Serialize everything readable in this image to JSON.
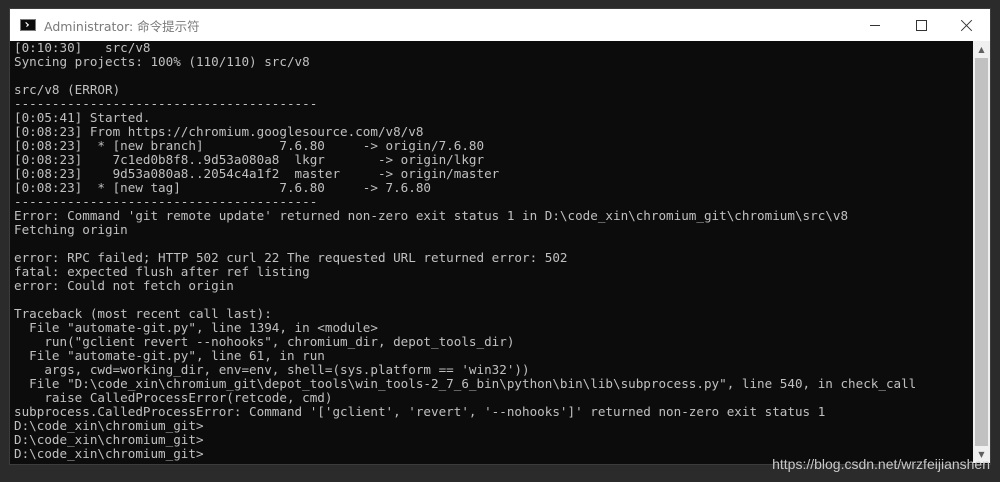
{
  "window": {
    "title": "Administrator: 命令提示符"
  },
  "console": {
    "lines": [
      "[0:10:30]   src/v8",
      "Syncing projects: 100% (110/110) src/v8",
      "",
      "src/v8 (ERROR)",
      "----------------------------------------",
      "[0:05:41] Started.",
      "[0:08:23] From https://chromium.googlesource.com/v8/v8",
      "[0:08:23]  * [new branch]          7.6.80     -> origin/7.6.80",
      "[0:08:23]    7c1ed0b8f8..9d53a080a8  lkgr       -> origin/lkgr",
      "[0:08:23]    9d53a080a8..2054c4a1f2  master     -> origin/master",
      "[0:08:23]  * [new tag]             7.6.80     -> 7.6.80",
      "----------------------------------------",
      "Error: Command 'git remote update' returned non-zero exit status 1 in D:\\code_xin\\chromium_git\\chromium\\src\\v8",
      "Fetching origin",
      "",
      "error: RPC failed; HTTP 502 curl 22 The requested URL returned error: 502",
      "fatal: expected flush after ref listing",
      "error: Could not fetch origin",
      "",
      "Traceback (most recent call last):",
      "  File \"automate-git.py\", line 1394, in <module>",
      "    run(\"gclient revert --nohooks\", chromium_dir, depot_tools_dir)",
      "  File \"automate-git.py\", line 61, in run",
      "    args, cwd=working_dir, env=env, shell=(sys.platform == 'win32'))",
      "  File \"D:\\code_xin\\chromium_git\\depot_tools\\win_tools-2_7_6_bin\\python\\bin\\lib\\subprocess.py\", line 540, in check_call",
      "    raise CalledProcessError(retcode, cmd)",
      "subprocess.CalledProcessError: Command '['gclient', 'revert', '--nohooks']' returned non-zero exit status 1",
      "D:\\code_xin\\chromium_git>",
      "D:\\code_xin\\chromium_git>",
      "D:\\code_xin\\chromium_git>"
    ]
  },
  "watermark": "https://blog.csdn.net/wrzfeijianshen"
}
